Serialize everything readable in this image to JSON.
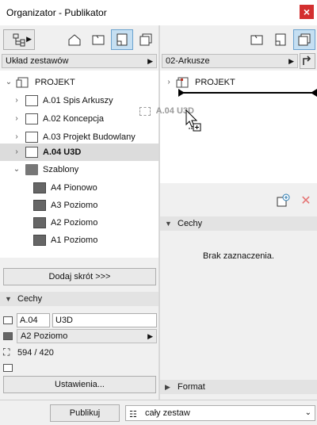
{
  "window": {
    "title": "Organizator - Publikator",
    "close": "×"
  },
  "left": {
    "combo": "Układ zestawów",
    "tree": [
      {
        "label": "PROJEKT",
        "icon": "book-icon"
      },
      {
        "label": "A.01 Spis Arkuszy",
        "icon": "sheet-icon"
      },
      {
        "label": "A.02 Koncepcja",
        "icon": "sheet-icon"
      },
      {
        "label": "A.03 Projekt Budowlany",
        "icon": "sheet-icon"
      },
      {
        "label": "A.04 U3D",
        "icon": "sheet-icon",
        "selected": true
      },
      {
        "label": "Szablony",
        "icon": "folder-icon"
      },
      {
        "label": "A4 Pionowo",
        "icon": "master-icon"
      },
      {
        "label": "A3 Poziomo",
        "icon": "master-icon"
      },
      {
        "label": "A2 Poziomo",
        "icon": "master-icon"
      },
      {
        "label": "A1 Poziomo",
        "icon": "master-icon"
      }
    ],
    "add_shortcut": "Dodaj skrót >>>",
    "props_header": "Cechy",
    "id_value": "A.04",
    "name_value": "U3D",
    "master_value": "A2 Poziomo",
    "size_value": "594 / 420",
    "settings_button": "Ustawienia..."
  },
  "right": {
    "combo": "02-Arkusze",
    "tree": [
      {
        "label": "PROJEKT",
        "icon": "book-icon"
      }
    ],
    "drag_ghost": "A.04 U3D",
    "props_header": "Cechy",
    "no_selection": "Brak zaznaczenia.",
    "format_header": "Format"
  },
  "bottom": {
    "publish_button": "Publikuj",
    "scope_value": "cały zestaw"
  }
}
